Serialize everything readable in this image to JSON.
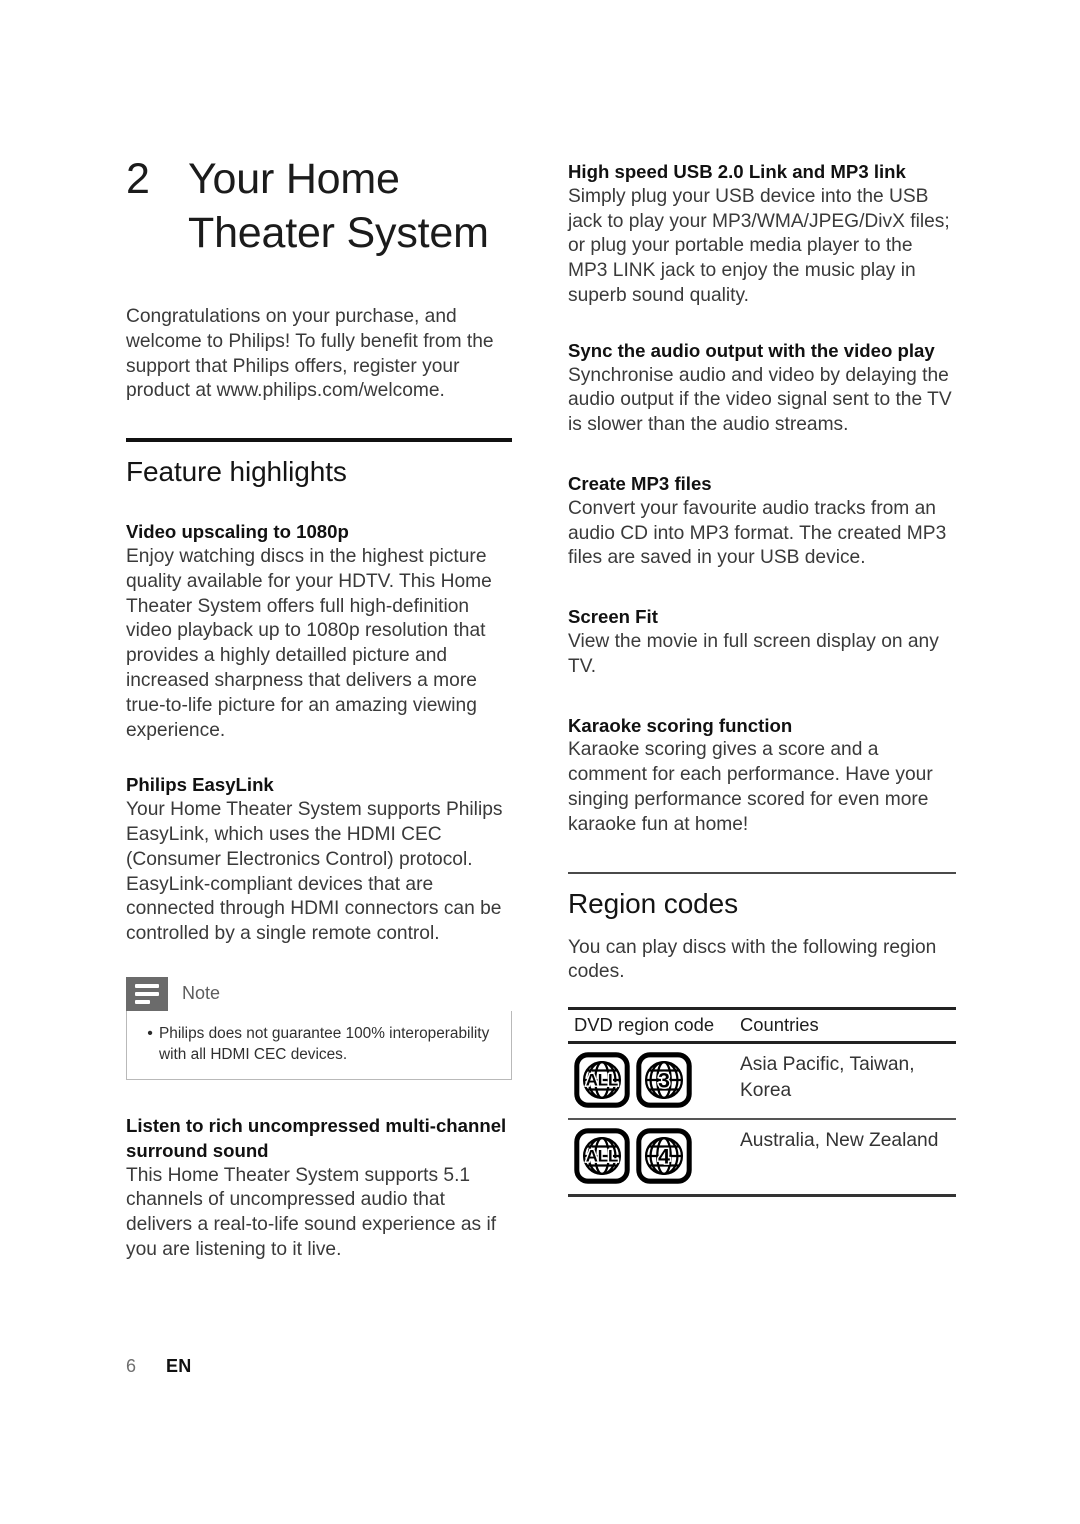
{
  "chapter": {
    "number": "2",
    "title_line1": "Your Home",
    "title_line2": "Theater System"
  },
  "intro": "Congratulations on your purchase, and welcome to Philips! To fully benefit from the support that Philips offers, register your product at www.philips.com/welcome.",
  "sections": {
    "feature_highlights": {
      "heading": "Feature highlights",
      "items": [
        {
          "heading": "Video upscaling to 1080p",
          "body": "Enjoy watching discs in the highest picture quality available for your HDTV. This Home Theater System offers full high-definition video playback up to 1080p resolution that provides a highly detailled picture and increased sharpness that delivers a more true-to-life picture for an amazing viewing experience."
        },
        {
          "heading": "Philips EasyLink",
          "body": "Your Home Theater System supports Philips EasyLink, which uses the HDMI CEC (Consumer Electronics Control) protocol. EasyLink-compliant devices that are connected through HDMI connectors can be controlled by a single remote control."
        },
        {
          "heading": "Listen to rich uncompressed multi-channel surround sound",
          "body": "This Home Theater System supports 5.1 channels of uncompressed audio that delivers a real-to-life sound experience as if you are listening to it live."
        },
        {
          "heading": "High speed USB 2.0 Link and MP3 link",
          "body": "Simply plug your USB device into the USB jack to play your MP3/WMA/JPEG/DivX files; or plug your portable media player to the MP3 LINK jack to enjoy the music play in superb sound quality."
        },
        {
          "heading": "Sync the audio output with the video play",
          "body": "Synchronise audio and video by delaying the audio output if the video signal sent to the TV is slower than the audio streams."
        },
        {
          "heading": "Create MP3 files",
          "body": "Convert your favourite audio tracks from an audio CD into MP3 format. The created MP3 files are saved in your USB device."
        },
        {
          "heading": "Screen Fit",
          "body": "View the movie in full screen display on any TV."
        },
        {
          "heading": "Karaoke scoring function",
          "body": "Karaoke scoring gives a score and a comment for each performance. Have your singing performance scored for even more karaoke fun at home!"
        }
      ]
    },
    "region_codes": {
      "heading": "Region codes",
      "intro": "You can play discs with the following region codes.",
      "table": {
        "columns": [
          "DVD region code",
          "Countries"
        ],
        "rows": [
          {
            "codes": [
              "ALL",
              "3"
            ],
            "countries": "Asia Pacific, Taiwan, Korea"
          },
          {
            "codes": [
              "ALL",
              "4"
            ],
            "countries": "Australia, New Zealand"
          }
        ]
      }
    }
  },
  "note": {
    "label": "Note",
    "bullet": "•",
    "text": "Philips does not guarantee 100% interoperability with all HDMI CEC devices."
  },
  "footer": {
    "page_number": "6",
    "language": "EN"
  },
  "colors": {
    "rule_dark": "#111111",
    "note_icon_bg": "#6b6b6b",
    "body_text": "#3a3a3a"
  }
}
